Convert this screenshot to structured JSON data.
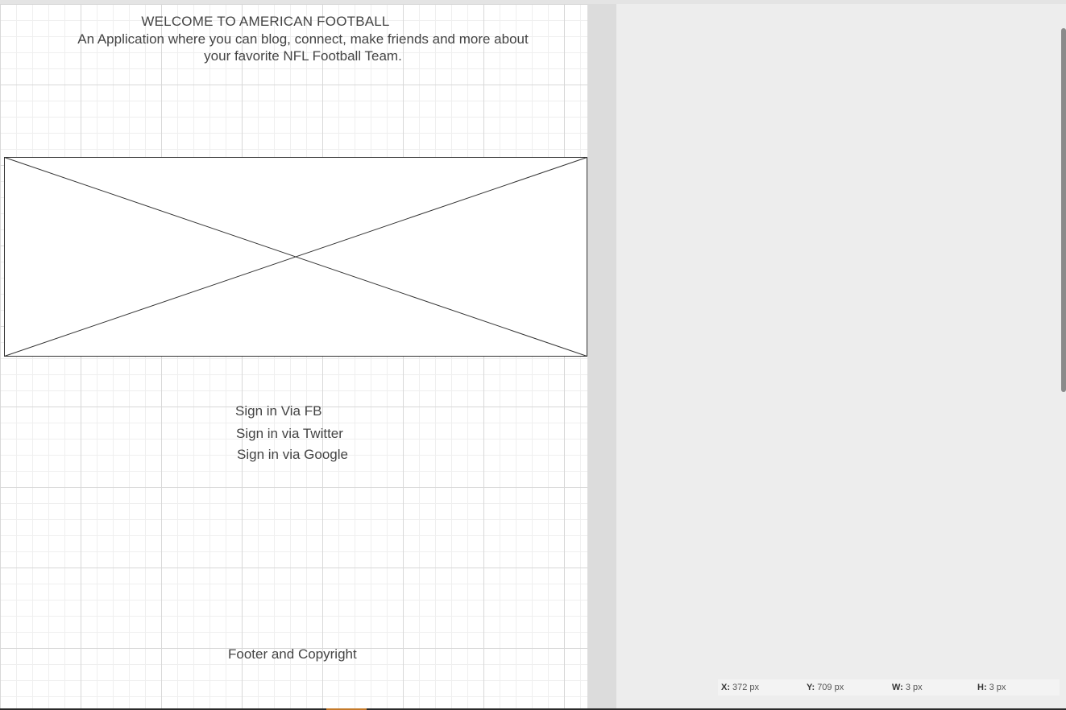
{
  "page": {
    "heading": "WELCOME TO AMERICAN FOOTBALL",
    "subtitle": "An Application where you can blog, connect, make friends and more about your favorite NFL Football Team."
  },
  "signin": {
    "fb": "Sign in Via FB",
    "twitter": "Sign in via Twitter",
    "google": "Sign in via Google"
  },
  "footer": {
    "text": "Footer and Copyright"
  },
  "status": {
    "x_label": "X:",
    "x_value": "372 px",
    "y_label": "Y:",
    "y_value": "709 px",
    "w_label": "W:",
    "w_value": "3 px",
    "h_label": "H:",
    "h_value": "3 px"
  },
  "colors": {
    "text": "#444444",
    "canvas": "#ffffff",
    "panel": "#ededed"
  }
}
